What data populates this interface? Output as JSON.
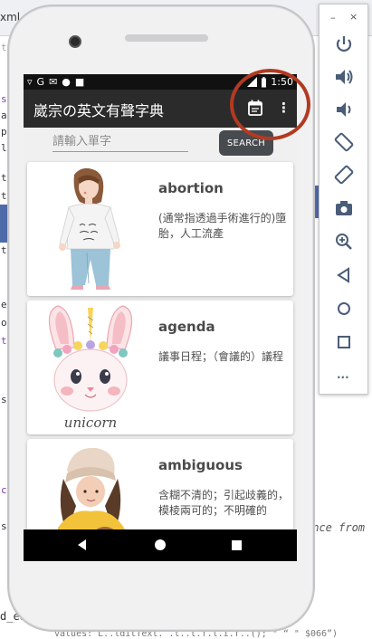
{
  "ide": {
    "tab_label": "xml",
    "tab_close": "×",
    "gutter_chars": [
      "t",
      "s",
      "a",
      "p",
      "l",
      "t",
      "t",
      "t",
      "e",
      "o",
      "t",
      "s",
      "c",
      "s"
    ],
    "code_fragment": "ence from",
    "bottom_left": "d_ed",
    "bottom_code": "Values: L..lditText. .t..t.f.l.i.f..(); \" “ \" $066”)"
  },
  "emulator_panel": {
    "minimize": "–",
    "close": "×",
    "buttons": [
      "power-icon",
      "volume-up-icon",
      "volume-down-icon",
      "rotate-left-icon",
      "rotate-right-icon",
      "camera-icon",
      "zoom-in-icon",
      "back-icon",
      "home-icon",
      "overview-icon"
    ],
    "more": "..."
  },
  "status_bar": {
    "icons": [
      "▿",
      "G",
      "✉",
      "●",
      "■"
    ],
    "time": "1:50"
  },
  "app": {
    "title": "崴宗の英文有聲字典",
    "menu_icon": "⋮"
  },
  "search": {
    "placeholder": "請輸入單字",
    "button_label": "SEARCH"
  },
  "words": [
    {
      "word": "abortion",
      "definition": "(通常指透過手術進行的)墮胎，人工流產",
      "image": "woman-illustration"
    },
    {
      "word": "agenda",
      "definition": "議事日程；（會議的）議程",
      "image": "unicorn-bunny-illustration",
      "image_caption": "It's a unicorn"
    },
    {
      "word": "ambiguous",
      "definition": "含糊不清的；引起歧義的，模棱兩可的；不明確的",
      "image": "girl-with-dog-illustration"
    }
  ],
  "colors": {
    "appbar": "#2b2b2b",
    "search_button": "#474a4f",
    "annotation": "#b23a22",
    "ide_accent": "#4e6aa7"
  }
}
